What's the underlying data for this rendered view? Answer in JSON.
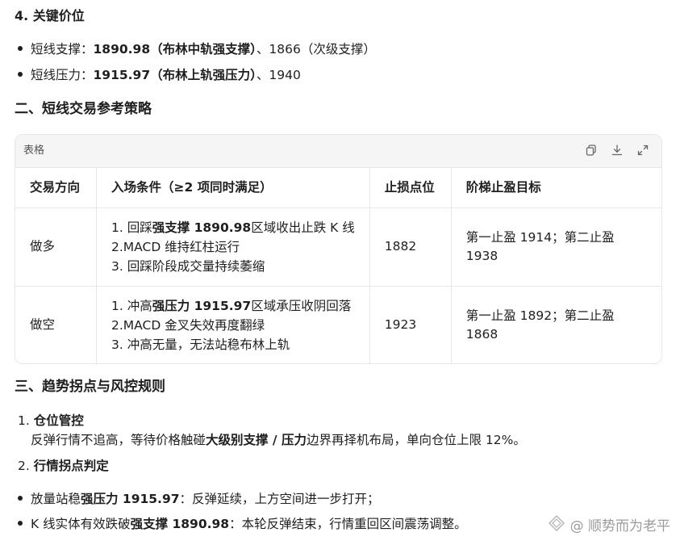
{
  "section4": {
    "title": "4. 关键价位",
    "support": {
      "label": "短线支撑：",
      "bold": "1890.98（布林中轨强支撑）",
      "rest": "、1866（次级支撑）"
    },
    "resistance": {
      "label": "短线压力：",
      "bold": "1915.97（布林上轨强压力）",
      "rest": "、1940"
    }
  },
  "section2": {
    "title": "二、短线交易参考策略"
  },
  "table": {
    "card_title": "表格",
    "headers": [
      "交易方向",
      "入场条件（≥2 项同时满足）",
      "止损点位",
      "阶梯止盈目标"
    ],
    "rows": [
      {
        "direction": "做多",
        "cond1_pre": "1. 回踩",
        "cond1_bold": "强支撑 1890.98",
        "cond1_post": "区域收出止跌 K 线",
        "cond2": "2.MACD 维持红柱运行",
        "cond3": "3. 回踩阶段成交量持续萎缩",
        "stop": "1882",
        "target": "第一止盈 1914；第二止盈 1938"
      },
      {
        "direction": "做空",
        "cond1_pre": "1. 冲高",
        "cond1_bold": "强压力 1915.97",
        "cond1_post": "区域承压收阴回落",
        "cond2": "2.MACD 金叉失效再度翻绿",
        "cond3": "3. 冲高无量，无法站稳布林上轨",
        "stop": "1923",
        "target": "第一止盈 1892；第二止盈 1868"
      }
    ]
  },
  "section3": {
    "title": "三、趋势拐点与风控规则",
    "item1": {
      "num": "1. ",
      "title": "仓位管控",
      "desc_pre": "反弹行情不追高，等待价格触碰",
      "desc_bold": "大级别支撑 / 压力",
      "desc_post": "边界再择机布局，单向仓位上限 12%。"
    },
    "item2": {
      "num": "2. ",
      "title": "行情拐点判定"
    },
    "bullet1": {
      "pre": "放量站稳",
      "bold": "强压力 1915.97",
      "post": "：反弹延续，上方空间进一步打开；"
    },
    "bullet2": {
      "pre": "K 线实体有效跌破",
      "bold": "强支撑 1890.98",
      "post": "：本轮反弹结束，行情重回区间震荡调整。"
    }
  },
  "watermark": "@ 顺势而为老平",
  "icons": [
    "copy-icon",
    "download-icon",
    "expand-icon",
    "watermark-logo-icon"
  ]
}
